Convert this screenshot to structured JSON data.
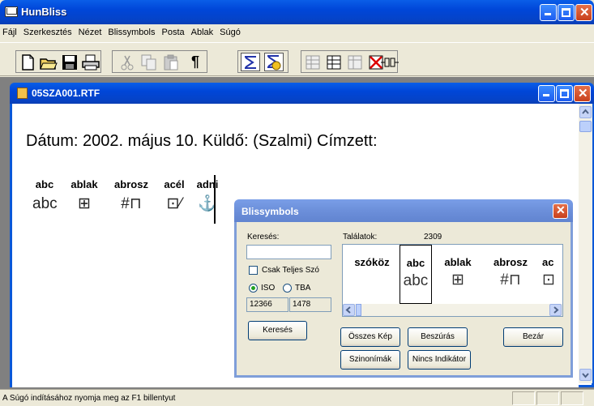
{
  "app": {
    "title": "HunBliss"
  },
  "menu": [
    "Fájl",
    "Szerkesztés",
    "Nézet",
    "Blissymbols",
    "Posta",
    "Ablak",
    "Súgó"
  ],
  "document": {
    "title": "05SZA001.RTF",
    "line": "Dátum: 2002. május 10.  Küldő:  (Szalmi)  Címzett:",
    "words": [
      {
        "word": "abc",
        "symbol": "abc"
      },
      {
        "word": "ablak",
        "symbol": "⊞"
      },
      {
        "word": "abrosz",
        "symbol": "#⊓"
      },
      {
        "word": "acél",
        "symbol": "⊡⁄"
      },
      {
        "word": "adni",
        "symbol": "⚓"
      }
    ]
  },
  "dialog": {
    "title": "Blissymbols",
    "search_label": "Keresés:",
    "search_value": "",
    "full_word_label": "Csak Teljes Szó",
    "full_word_checked": false,
    "radio_iso": "ISO",
    "radio_tba": "TBA",
    "iso_value": "12366",
    "tba_value": "1478",
    "search_button": "Keresés",
    "results_label": "Találatok:",
    "results_count": "2309",
    "results": [
      {
        "word": "szóköz",
        "symbol": ""
      },
      {
        "word": "abc",
        "symbol": "abc"
      },
      {
        "word": "ablak",
        "symbol": "⊞"
      },
      {
        "word": "abrosz",
        "symbol": "#⊓"
      },
      {
        "word": "ac",
        "symbol": "⊡"
      }
    ],
    "buttons": {
      "all_images": "Összes Kép",
      "insert": "Beszúrás",
      "close": "Bezár",
      "synonyms": "Szinonímák",
      "no_indicator": "Nincs Indikátor"
    }
  },
  "status": {
    "message": "A Súgó indításához nyomja meg az F1 billentyut"
  }
}
